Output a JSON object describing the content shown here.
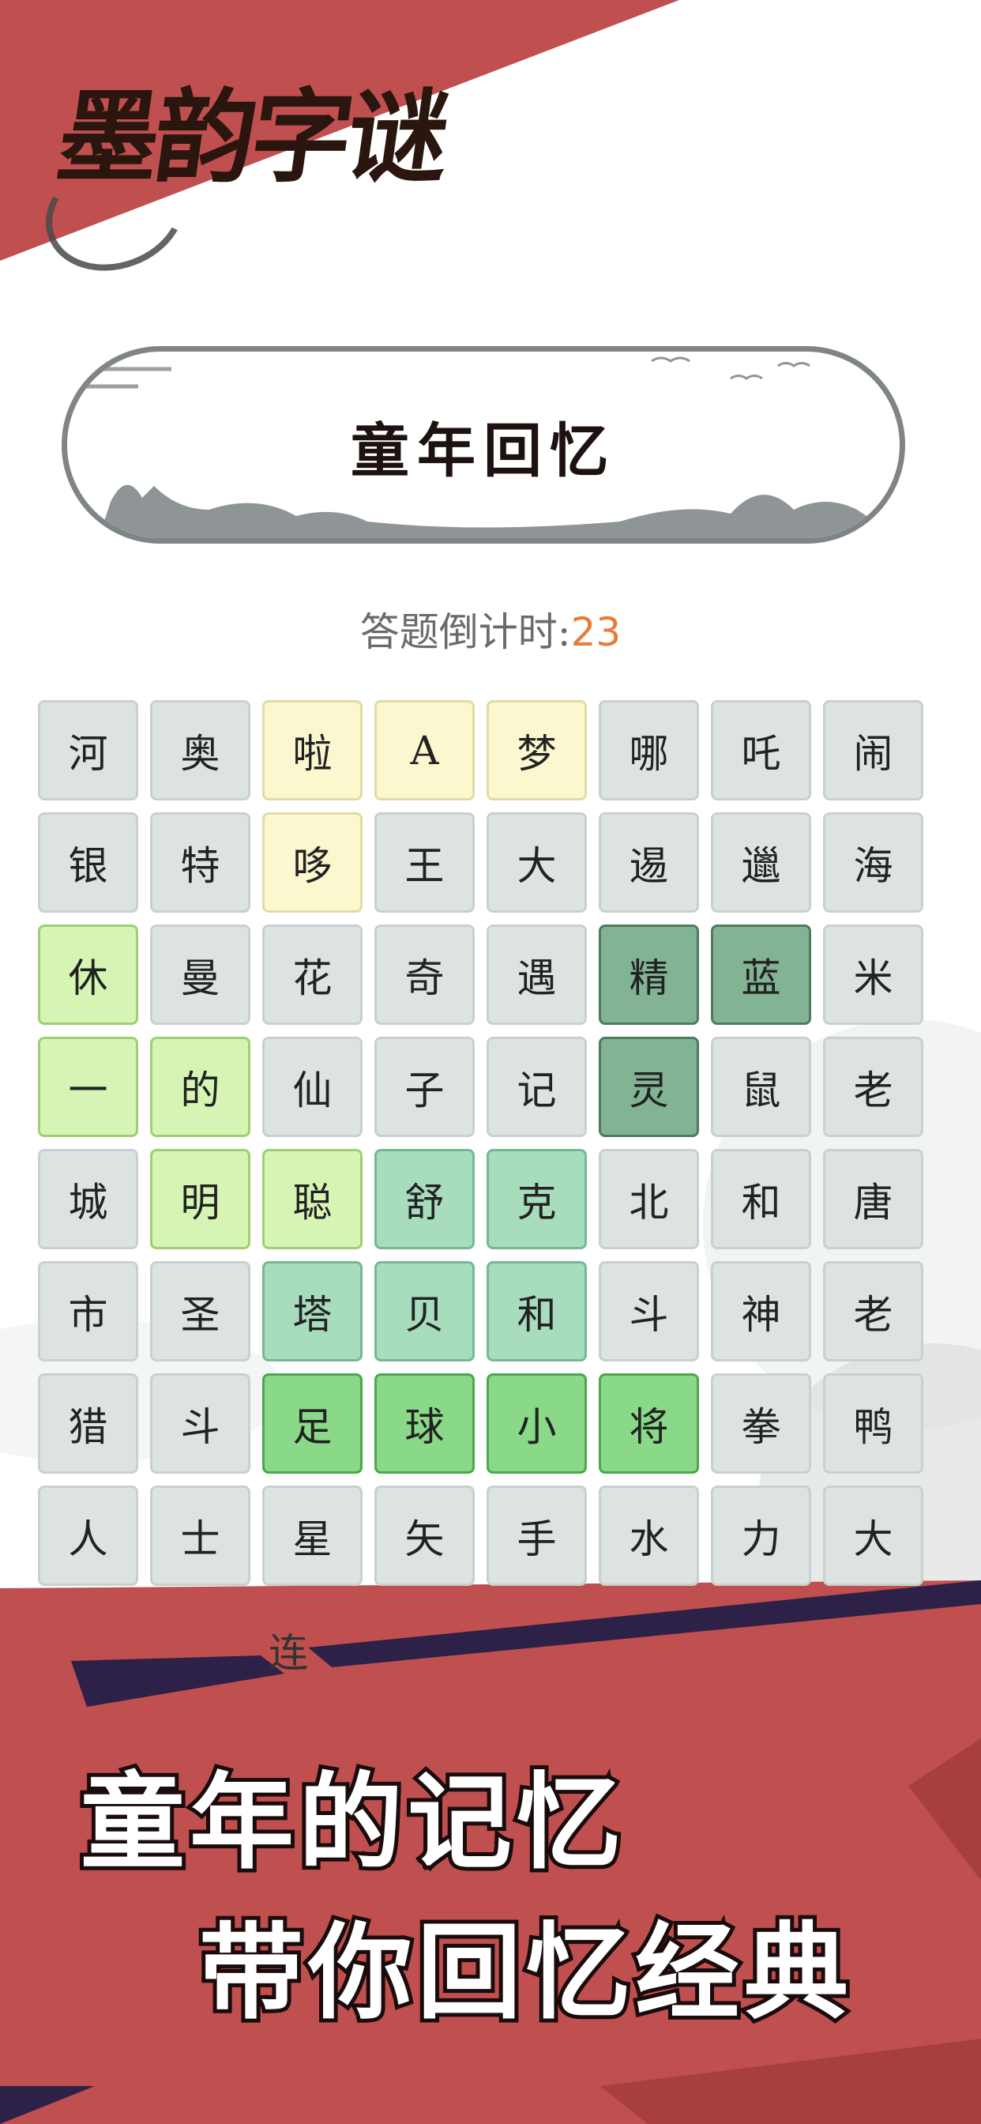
{
  "app": {
    "logo_text": "墨韵字谜"
  },
  "banner": {
    "title": "童年回忆"
  },
  "countdown": {
    "label": "答题倒计时:",
    "value": "23"
  },
  "grid": {
    "rows": [
      [
        {
          "ch": "河",
          "state": "default"
        },
        {
          "ch": "奥",
          "state": "default"
        },
        {
          "ch": "啦",
          "state": "yellow"
        },
        {
          "ch": "A",
          "state": "yellow"
        },
        {
          "ch": "梦",
          "state": "yellow"
        },
        {
          "ch": "哪",
          "state": "default"
        },
        {
          "ch": "吒",
          "state": "default"
        },
        {
          "ch": "闹",
          "state": "default"
        }
      ],
      [
        {
          "ch": "银",
          "state": "default"
        },
        {
          "ch": "特",
          "state": "default"
        },
        {
          "ch": "哆",
          "state": "yellow"
        },
        {
          "ch": "王",
          "state": "default"
        },
        {
          "ch": "大",
          "state": "default"
        },
        {
          "ch": "逷",
          "state": "default"
        },
        {
          "ch": "邋",
          "state": "default"
        },
        {
          "ch": "海",
          "state": "default"
        }
      ],
      [
        {
          "ch": "休",
          "state": "lime"
        },
        {
          "ch": "曼",
          "state": "default"
        },
        {
          "ch": "花",
          "state": "default"
        },
        {
          "ch": "奇",
          "state": "default"
        },
        {
          "ch": "遇",
          "state": "default"
        },
        {
          "ch": "精",
          "state": "dark"
        },
        {
          "ch": "蓝",
          "state": "dark"
        },
        {
          "ch": "米",
          "state": "default"
        }
      ],
      [
        {
          "ch": "一",
          "state": "lime"
        },
        {
          "ch": "的",
          "state": "lime"
        },
        {
          "ch": "仙",
          "state": "default"
        },
        {
          "ch": "子",
          "state": "default"
        },
        {
          "ch": "记",
          "state": "default"
        },
        {
          "ch": "灵",
          "state": "dark"
        },
        {
          "ch": "鼠",
          "state": "default"
        },
        {
          "ch": "老",
          "state": "default"
        }
      ],
      [
        {
          "ch": "城",
          "state": "default"
        },
        {
          "ch": "明",
          "state": "lime"
        },
        {
          "ch": "聪",
          "state": "lime"
        },
        {
          "ch": "舒",
          "state": "teal"
        },
        {
          "ch": "克",
          "state": "teal"
        },
        {
          "ch": "北",
          "state": "default"
        },
        {
          "ch": "和",
          "state": "default"
        },
        {
          "ch": "唐",
          "state": "default"
        }
      ],
      [
        {
          "ch": "市",
          "state": "default"
        },
        {
          "ch": "圣",
          "state": "default"
        },
        {
          "ch": "塔",
          "state": "teal"
        },
        {
          "ch": "贝",
          "state": "teal"
        },
        {
          "ch": "和",
          "state": "teal"
        },
        {
          "ch": "斗",
          "state": "default"
        },
        {
          "ch": "神",
          "state": "default"
        },
        {
          "ch": "老",
          "state": "default"
        }
      ],
      [
        {
          "ch": "猎",
          "state": "default"
        },
        {
          "ch": "斗",
          "state": "default"
        },
        {
          "ch": "足",
          "state": "green"
        },
        {
          "ch": "球",
          "state": "green"
        },
        {
          "ch": "小",
          "state": "green"
        },
        {
          "ch": "将",
          "state": "green"
        },
        {
          "ch": "拳",
          "state": "default"
        },
        {
          "ch": "鸭",
          "state": "default"
        }
      ],
      [
        {
          "ch": "人",
          "state": "default"
        },
        {
          "ch": "士",
          "state": "default"
        },
        {
          "ch": "星",
          "state": "default"
        },
        {
          "ch": "矢",
          "state": "default"
        },
        {
          "ch": "手",
          "state": "default"
        },
        {
          "ch": "水",
          "state": "default"
        },
        {
          "ch": "力",
          "state": "default"
        },
        {
          "ch": "大",
          "state": "default"
        }
      ]
    ]
  },
  "partial_label": "连",
  "promo": {
    "line1": "童年的记忆",
    "line2": "带你回忆经典"
  },
  "colors": {
    "brand_red": "#c04f4f",
    "accent_navy": "#2d2147",
    "countdown_number": "#e67c36"
  }
}
